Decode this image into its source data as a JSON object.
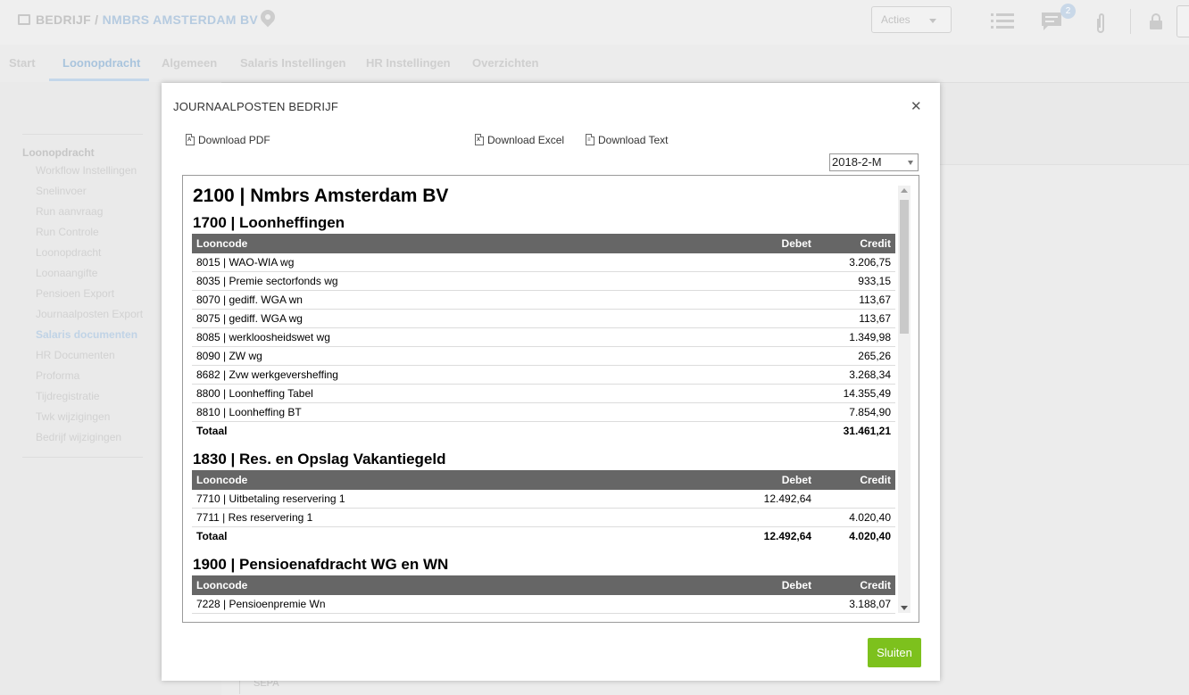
{
  "app": {
    "breadcrumb_prefix": "BEDRIJF / ",
    "breadcrumb_company": "NMBRS AMSTERDAM BV",
    "acties_label": "Acties",
    "chat_badge": "2"
  },
  "tabs": [
    "Start",
    "Loonopdracht",
    "Algemeen",
    "Salaris Instellingen",
    "HR Instellingen",
    "Overzichten"
  ],
  "sidebar": {
    "title": "Loonopdracht",
    "items": [
      "Workflow Instellingen",
      "Snelinvoer",
      "Run aanvraag",
      "Run Controle",
      "Loonopdracht",
      "Loonaangifte",
      "Pensioen Export",
      "Journaalposten Export",
      "Salaris documenten",
      "HR Documenten",
      "Proforma",
      "Tijdregistratie",
      "Twk wijzigingen",
      "Bedrijf wijzigingen"
    ]
  },
  "background_content": {
    "sepa": "SEPA"
  },
  "modal": {
    "title": "JOURNAALPOSTEN BEDRIJF",
    "download_pdf": "Download PDF",
    "download_excel": "Download Excel",
    "download_text": "Download Text",
    "period": "2018-2-M",
    "close_button": "Sluiten"
  },
  "report": {
    "company": "2100 | Nmbrs Amsterdam BV",
    "headers": {
      "code": "Looncode",
      "debet": "Debet",
      "credit": "Credit"
    },
    "total_label": "Totaal",
    "sections": [
      {
        "title": "1700 | Loonheffingen",
        "rows": [
          {
            "code": "8015 | WAO-WIA wg",
            "debet": "",
            "credit": "3.206,75"
          },
          {
            "code": "8035 | Premie sectorfonds wg",
            "debet": "",
            "credit": "933,15"
          },
          {
            "code": "8070 | gediff. WGA wn",
            "debet": "",
            "credit": "113,67"
          },
          {
            "code": "8075 | gediff. WGA wg",
            "debet": "",
            "credit": "113,67"
          },
          {
            "code": "8085 | werkloosheidswet wg",
            "debet": "",
            "credit": "1.349,98"
          },
          {
            "code": "8090 | ZW wg",
            "debet": "",
            "credit": "265,26"
          },
          {
            "code": "8682 | Zvw werkgeversheffing",
            "debet": "",
            "credit": "3.268,34"
          },
          {
            "code": "8800 | Loonheffing Tabel",
            "debet": "",
            "credit": "14.355,49"
          },
          {
            "code": "8810 | Loonheffing BT",
            "debet": "",
            "credit": "7.854,90"
          }
        ],
        "total": {
          "debet": "",
          "credit": "31.461,21"
        }
      },
      {
        "title": "1830 | Res. en Opslag Vakantiegeld",
        "rows": [
          {
            "code": "7710 | Uitbetaling reservering 1",
            "debet": "12.492,64",
            "credit": ""
          },
          {
            "code": "7711 | Res reservering 1",
            "debet": "",
            "credit": "4.020,40"
          }
        ],
        "total": {
          "debet": "12.492,64",
          "credit": "4.020,40"
        }
      },
      {
        "title": "1900 | Pensioenafdracht WG en WN",
        "rows": [
          {
            "code": "7228 | Pensioenpremie Wn",
            "debet": "",
            "credit": "3.188,07"
          }
        ]
      }
    ]
  }
}
